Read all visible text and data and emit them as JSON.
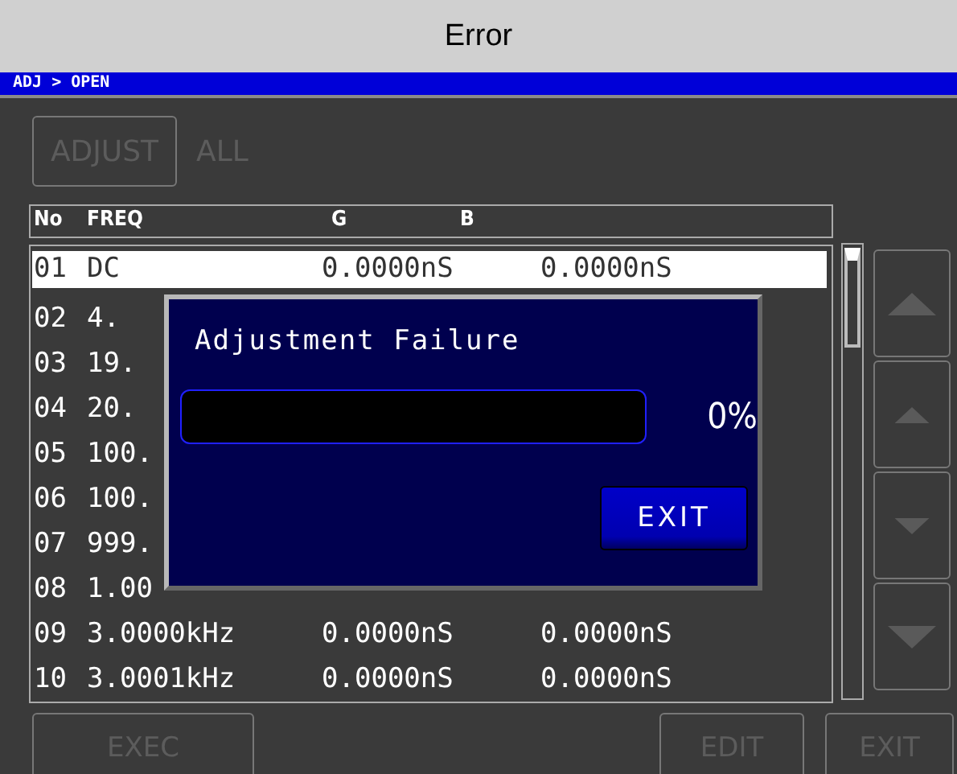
{
  "window": {
    "title": "Error"
  },
  "breadcrumb": "ADJ > OPEN",
  "adjust_button": {
    "label": "ADJUST",
    "disabled": true
  },
  "adjust_mode": "ALL",
  "table": {
    "columns": [
      "No",
      "FREQ",
      "G",
      "B"
    ],
    "rows": [
      {
        "no": "01",
        "freq": "DC",
        "g": "0.0000nS",
        "b": "0.0000nS",
        "selected": true
      },
      {
        "no": "02",
        "freq": "4.",
        "selected": false
      },
      {
        "no": "03",
        "freq": "19.",
        "selected": false
      },
      {
        "no": "04",
        "freq": "20.",
        "selected": false
      },
      {
        "no": "05",
        "freq": "100.",
        "selected": false
      },
      {
        "no": "06",
        "freq": "100.",
        "selected": false
      },
      {
        "no": "07",
        "freq": "999.",
        "selected": false
      },
      {
        "no": "08",
        "freq": "1.00",
        "selected": false
      },
      {
        "no": "09",
        "freq": "3.0000kHz",
        "g": "0.0000nS",
        "b": "0.0000nS",
        "selected": false
      },
      {
        "no": "10",
        "freq": "3.0001kHz",
        "g": "0.0000nS",
        "b": "0.0000nS",
        "selected": false
      }
    ]
  },
  "side_buttons": [
    {
      "kind": "page-up",
      "disabled": true
    },
    {
      "kind": "up",
      "disabled": true
    },
    {
      "kind": "down",
      "disabled": true
    },
    {
      "kind": "page-down",
      "disabled": true
    }
  ],
  "bottom_buttons": [
    {
      "label": "EXEC",
      "disabled": true
    },
    {
      "label": "EDIT",
      "disabled": true
    },
    {
      "label": "EXIT",
      "disabled": true
    }
  ],
  "dialog": {
    "message": "Adjustment Failure",
    "progress": {
      "level": 0,
      "reading": "0%"
    },
    "button": "EXIT"
  }
}
